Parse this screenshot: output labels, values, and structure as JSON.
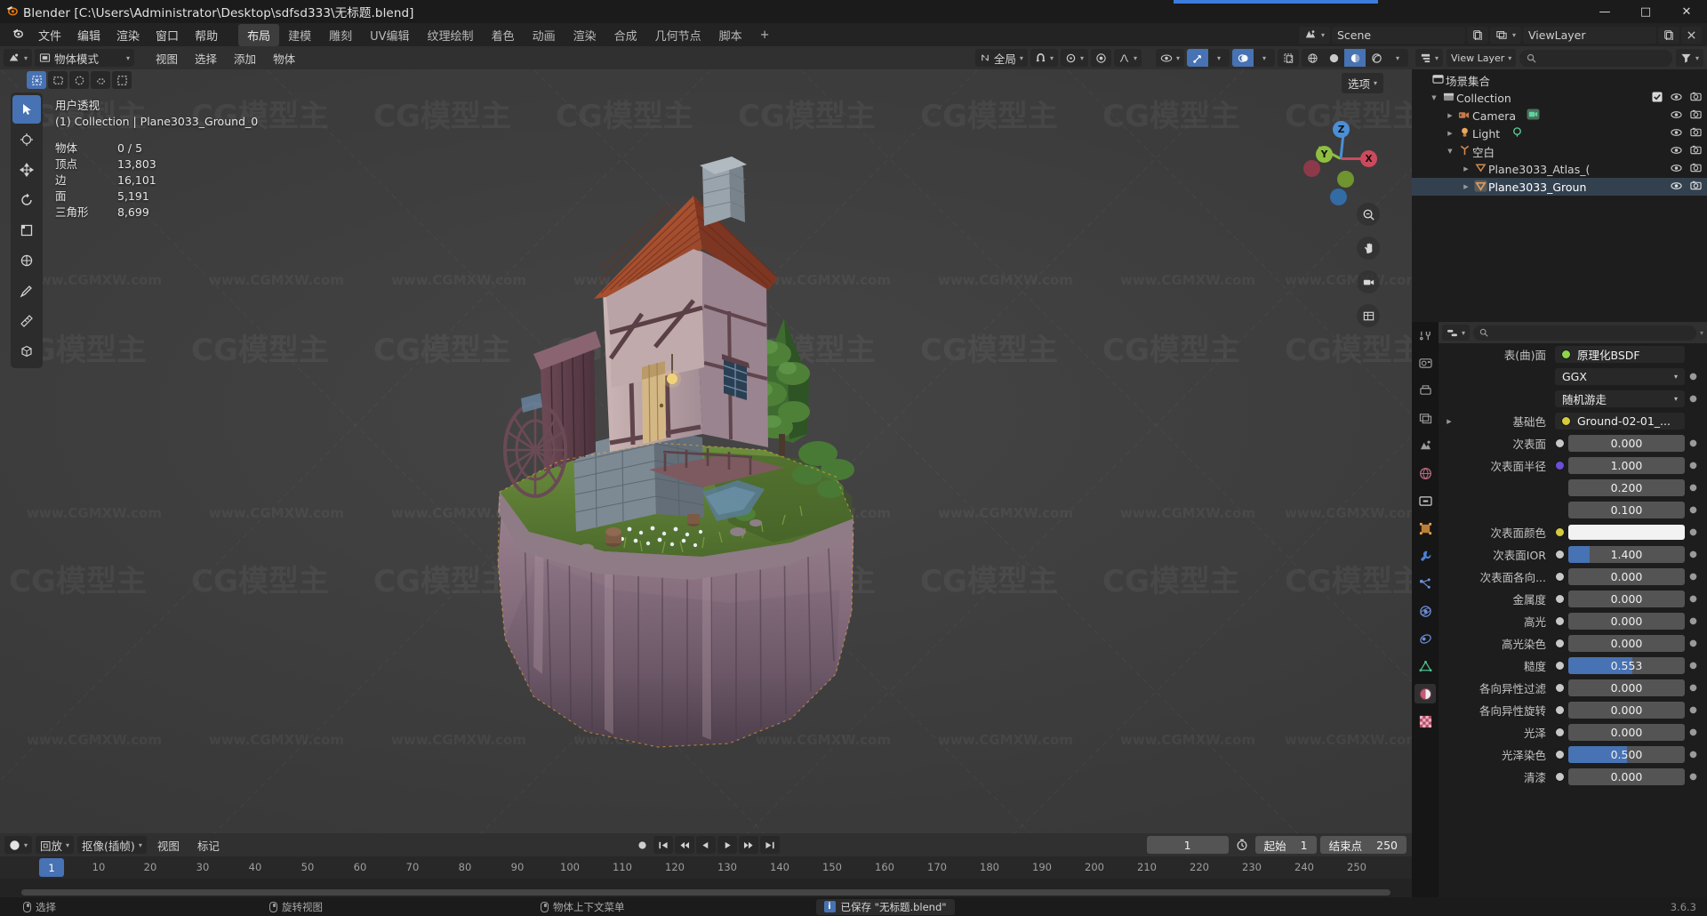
{
  "titlebar": {
    "app_title": "Blender [C:\\Users\\Administrator\\Desktop\\sdfsd333\\无标题.blend]",
    "minimize": "—",
    "maximize": "□",
    "close": "✕"
  },
  "topmenu": {
    "menus": [
      "文件",
      "编辑",
      "渲染",
      "窗口",
      "帮助"
    ],
    "workspaces": [
      "布局",
      "建模",
      "雕刻",
      "UV编辑",
      "纹理绘制",
      "着色",
      "动画",
      "渲染",
      "合成",
      "几何节点",
      "脚本",
      "+"
    ],
    "active_workspace": "布局",
    "scene_name": "Scene",
    "viewlayer_name": "ViewLayer"
  },
  "viewport_header": {
    "mode": "物体模式",
    "menus": [
      "视图",
      "选择",
      "添加",
      "物体"
    ],
    "transform_orientation": "全局",
    "snap_label": "",
    "proportional_label": ""
  },
  "viewport": {
    "overlay_view": "用户透视",
    "overlay_collection": "(1) Collection | Plane3033_Ground_0",
    "stats": [
      {
        "label": "物体",
        "value": "0 / 5"
      },
      {
        "label": "顶点",
        "value": "13,803"
      },
      {
        "label": "边",
        "value": "16,101"
      },
      {
        "label": "面",
        "value": "5,191"
      },
      {
        "label": "三角形",
        "value": "8,699"
      }
    ],
    "options_label": "选项",
    "gizmo_axes": [
      "Z",
      "Y",
      "X"
    ],
    "watermark_big": "CG模型主",
    "watermark_small": "www.CGMXW.com"
  },
  "outliner": {
    "search_placeholder": "",
    "root_label": "场景集合",
    "items": [
      {
        "label": "Collection",
        "icon": "collection-icon",
        "indent": 0,
        "expanded": true,
        "has_checkbox": true,
        "selected": false
      },
      {
        "label": "Camera",
        "icon": "camera-icon",
        "indent": 1,
        "expanded": false,
        "has_checkbox": false,
        "selected": false
      },
      {
        "label": "Light",
        "icon": "light-icon",
        "indent": 1,
        "expanded": false,
        "has_checkbox": false,
        "selected": false
      },
      {
        "label": "空白",
        "icon": "empty-axes-icon",
        "indent": 1,
        "expanded": true,
        "has_checkbox": false,
        "selected": false
      },
      {
        "label": "Plane3033_Atlas_(",
        "icon": "mesh-icon",
        "indent": 2,
        "expanded": false,
        "has_checkbox": false,
        "selected": false
      },
      {
        "label": "Plane3033_Groun",
        "icon": "mesh-icon",
        "indent": 2,
        "expanded": false,
        "has_checkbox": false,
        "selected": true
      }
    ]
  },
  "properties": {
    "search_placeholder": "",
    "tabs": [
      "tool-icon",
      "render-icon",
      "output-icon",
      "viewlayer-icon",
      "scene-icon",
      "world-icon",
      "collection-icon",
      "object-icon",
      "modifier-icon",
      "particles-icon",
      "physics-icon",
      "constraint-icon",
      "data-icon",
      "material-icon",
      "texture-icon"
    ],
    "active_tab_index": 13,
    "surface_row": {
      "label": "表(曲)面",
      "value": "原理化BSDF",
      "socket_color": "#8fd44b"
    },
    "rows": [
      {
        "label": "",
        "type": "dropdown",
        "value": "GGX"
      },
      {
        "label": "",
        "type": "dropdown",
        "value": "随机游走"
      },
      {
        "label": "基础色",
        "type": "name",
        "value": "Ground-02-01_...",
        "socket_color": "#d6cb3c",
        "expandable": true
      },
      {
        "label": "次表面",
        "type": "slider",
        "value": "0.000",
        "fill": 0,
        "socket_color": "#c8c8c8"
      },
      {
        "label": "次表面半径",
        "type": "slider",
        "value": "1.000",
        "fill": 0,
        "socket_color": "#6b4fd8"
      },
      {
        "label": "",
        "type": "slider",
        "value": "0.200",
        "fill": 0
      },
      {
        "label": "",
        "type": "slider",
        "value": "0.100",
        "fill": 0
      },
      {
        "label": "次表面颜色",
        "type": "color",
        "value": "",
        "swatch": "#f2f2f2",
        "socket_color": "#d6cb3c"
      },
      {
        "label": "次表面IOR",
        "type": "slider",
        "value": "1.400",
        "fill": 18,
        "socket_color": "#c8c8c8"
      },
      {
        "label": "次表面各向...",
        "type": "slider",
        "value": "0.000",
        "fill": 0,
        "socket_color": "#c8c8c8"
      },
      {
        "label": "金属度",
        "type": "slider",
        "value": "0.000",
        "fill": 0,
        "socket_color": "#c8c8c8"
      },
      {
        "label": "高光",
        "type": "slider",
        "value": "0.000",
        "fill": 0,
        "socket_color": "#c8c8c8"
      },
      {
        "label": "高光染色",
        "type": "slider",
        "value": "0.000",
        "fill": 0,
        "socket_color": "#c8c8c8"
      },
      {
        "label": "糙度",
        "type": "slider",
        "value": "0.553",
        "fill": 55,
        "socket_color": "#c8c8c8"
      },
      {
        "label": "各向异性过滤",
        "type": "slider",
        "value": "0.000",
        "fill": 0,
        "socket_color": "#c8c8c8"
      },
      {
        "label": "各向异性旋转",
        "type": "slider",
        "value": "0.000",
        "fill": 0,
        "socket_color": "#c8c8c8"
      },
      {
        "label": "光泽",
        "type": "slider",
        "value": "0.000",
        "fill": 0,
        "socket_color": "#c8c8c8"
      },
      {
        "label": "光泽染色",
        "type": "slider",
        "value": "0.500",
        "fill": 50,
        "socket_color": "#c8c8c8"
      },
      {
        "label": "清漆",
        "type": "slider",
        "value": "0.000",
        "fill": 0,
        "socket_color": "#c8c8c8"
      }
    ]
  },
  "timeline": {
    "menus": [
      "视图",
      "标记"
    ],
    "playback_label": "回放",
    "keying_label": "抠像(插帧)",
    "current_frame": "1",
    "start_label": "起始",
    "start_value": "1",
    "end_label": "结束点",
    "end_value": "250",
    "ticks": [
      "10",
      "20",
      "30",
      "40",
      "50",
      "60",
      "70",
      "80",
      "90",
      "100",
      "110",
      "120",
      "130",
      "140",
      "150",
      "160",
      "170",
      "180",
      "190",
      "200",
      "210",
      "220",
      "230",
      "240",
      "250"
    ],
    "playhead_label": "1"
  },
  "statusbar": {
    "items": [
      "选择",
      "旋转视图",
      "物体上下文菜单"
    ],
    "saved_message": "已保存 \"无标题.blend\"",
    "version": "3.6.3"
  },
  "colors": {
    "accent_blue": "#4772b3",
    "orange": "#e87d0d",
    "panel_bg": "#1d1d1d",
    "header_bg": "#303030",
    "viewport_bg": "#3b3b3b"
  }
}
